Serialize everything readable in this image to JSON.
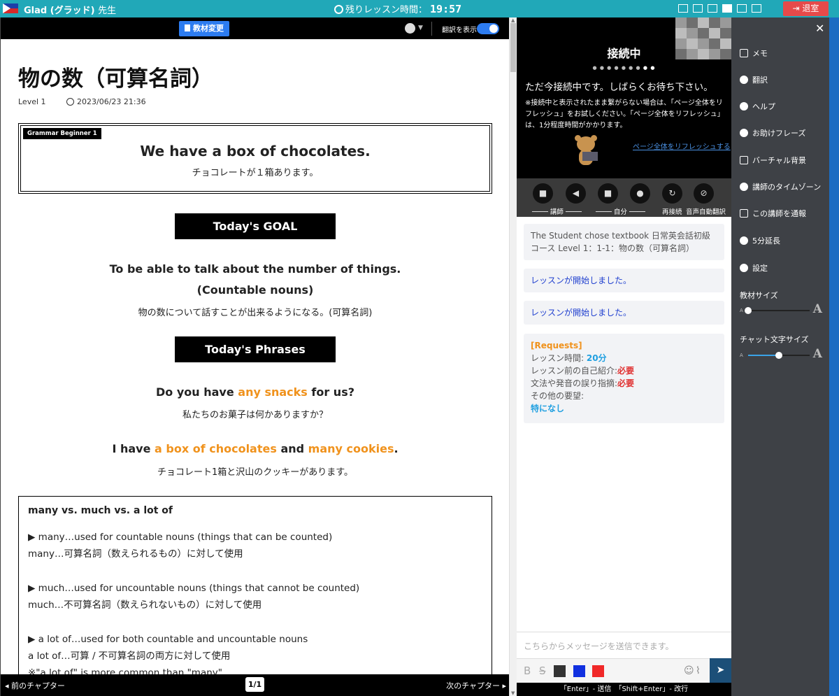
{
  "header": {
    "teacher_name": "Glad (グラッド)",
    "teacher_suffix": "先生",
    "timer_label": "残りレッスン時間：",
    "timer_value": "19:57",
    "exit_label": "退室"
  },
  "material_toolbar": {
    "change_button": "教材変更",
    "translate_label": "翻訳を表示"
  },
  "document": {
    "title": "物の数（可算名詞）",
    "level": "Level 1",
    "datetime": "2023/06/23 21:36",
    "grammar_tag": "Grammar Beginner 1",
    "grammar_en": "We have a box of chocolates.",
    "grammar_ja": "チョコレートが１箱あります。",
    "goal_heading": "Today's GOAL",
    "goal_line1": "To be able to talk about the number of things.",
    "goal_line2": "(Countable nouns)",
    "goal_ja": "物の数について話すことが出来るようになる。(可算名詞)",
    "phrases_heading": "Today's Phrases",
    "phrase1": {
      "a": "Do you have ",
      "b": "any snacks",
      "c": " for us?"
    },
    "phrase1_ja": "私たちのお菓子は何かありますか？",
    "phrase2": {
      "a": "I have ",
      "b": "a box of chocolates",
      "c": " and ",
      "d": "many cookies",
      "e": "."
    },
    "phrase2_ja": "チョコレート1箱と沢山のクッキーがあります。",
    "box_title": "many vs. much vs. a lot of",
    "box_lines": [
      "▶ many…used for countable nouns (things that can be counted)",
      "many…可算名詞（数えられるもの）に対して使用",
      "▶ much…used for uncountable nouns (things that cannot be counted)",
      "much…不可算名詞（数えられないもの）に対して使用",
      "▶ a lot of…used for both countable and uncountable nouns",
      "a lot of…可算 / 不可算名詞の両方に対して使用",
      "※\"a lot of\" is more common than \"many\""
    ]
  },
  "pager": {
    "prev": "前のチャプター",
    "page": "1/1",
    "next": "次のチャプター"
  },
  "video": {
    "status": "接続中",
    "waiting": "ただ今接続中です。しばらくお待ち下さい。",
    "note": "※接続中と表示されたまま繋がらない場合は、「ページ全体をリフレッシュ」をお試しください。「ページ全体をリフレッシュ」は、1分程度時間がかかります。",
    "refresh_link": "ページ全体をリフレッシュする"
  },
  "controls": {
    "teacher_label": "講師",
    "self_label": "自分",
    "reconnect_label": "再接続",
    "autotranslate_label": "音声自動翻訳"
  },
  "chat": {
    "msg1": "The Student chose textbook 日常英会話初級コース Level 1：1-1：物の数（可算名詞）",
    "msg2": "レッスンが開始しました。",
    "msg3": "レッスンが開始しました。",
    "requests": {
      "title": "[Requests]",
      "time_label": "レッスン時間: ",
      "time_value": "20分",
      "intro_label": "レッスン前の自己紹介:",
      "intro_value": "必要",
      "correction_label": "文法や発音の誤り指摘:",
      "correction_value": "必要",
      "other_label": "その他の要望:",
      "other_value": "特になし"
    },
    "input_placeholder": "こちらからメッセージを送信できます。",
    "hint": "「Enter」- 送信　「Shift+Enter」- 改行",
    "colors": [
      "#333333",
      "#1030e0",
      "#f02828"
    ]
  },
  "side_menu": {
    "items": [
      "メモ",
      "翻訳",
      "ヘルプ",
      "お助けフレーズ",
      "バーチャル背景",
      "講師のタイムゾーン",
      "この講師を通報",
      "5分延長",
      "設定"
    ],
    "material_size_label": "教材サイズ",
    "material_size_level": 0,
    "chat_size_label": "チャット文字サイズ",
    "chat_size_level": 0.5
  }
}
